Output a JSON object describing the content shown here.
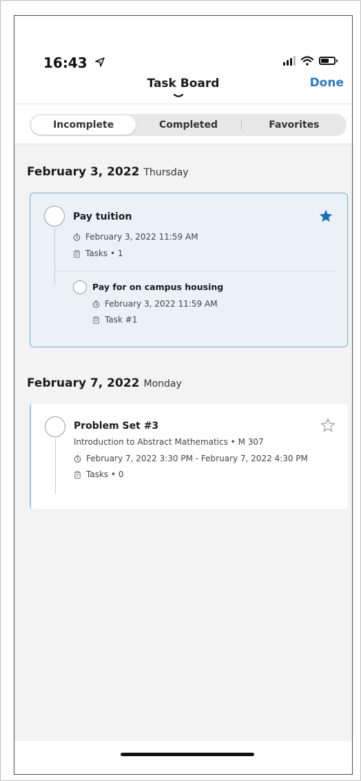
{
  "status_bar": {
    "time": "16:43"
  },
  "nav": {
    "title": "Task Board",
    "done_label": "Done"
  },
  "tabs": [
    {
      "label": "Incomplete",
      "active": true
    },
    {
      "label": "Completed",
      "active": false
    },
    {
      "label": "Favorites",
      "active": false
    }
  ],
  "groups": [
    {
      "date": "February 3, 2022",
      "weekday": "Thursday",
      "task": {
        "title": "Pay tuition",
        "favorite": true,
        "due": "February 3, 2022 11:59 AM",
        "tasks": "Tasks • 1",
        "subtask": {
          "title": "Pay for on campus housing",
          "due": "February 3, 2022 11:59 AM",
          "tasks": "Task #1"
        }
      }
    },
    {
      "date": "February 7, 2022",
      "weekday": "Monday",
      "task": {
        "title": "Problem Set #3",
        "favorite": false,
        "course": "Introduction to Abstract Mathematics • M 307",
        "due": "February 7, 2022 3:30 PM - February 7, 2022 4:30 PM",
        "tasks": "Tasks • 0"
      }
    }
  ],
  "colors": {
    "accent": "#2a7bb8",
    "selected_card_bg": "#eaf2f8",
    "selected_card_border": "#7fa8c6",
    "star_filled": "#1f6fb0"
  },
  "icons": {
    "location": "location-arrow-icon",
    "signal": "cellular-signal-icon",
    "wifi": "wifi-icon",
    "battery": "battery-icon",
    "chevron": "chevron-down-icon",
    "clock": "clock-icon",
    "tasks": "clipboard-icon",
    "star": "star-icon"
  }
}
